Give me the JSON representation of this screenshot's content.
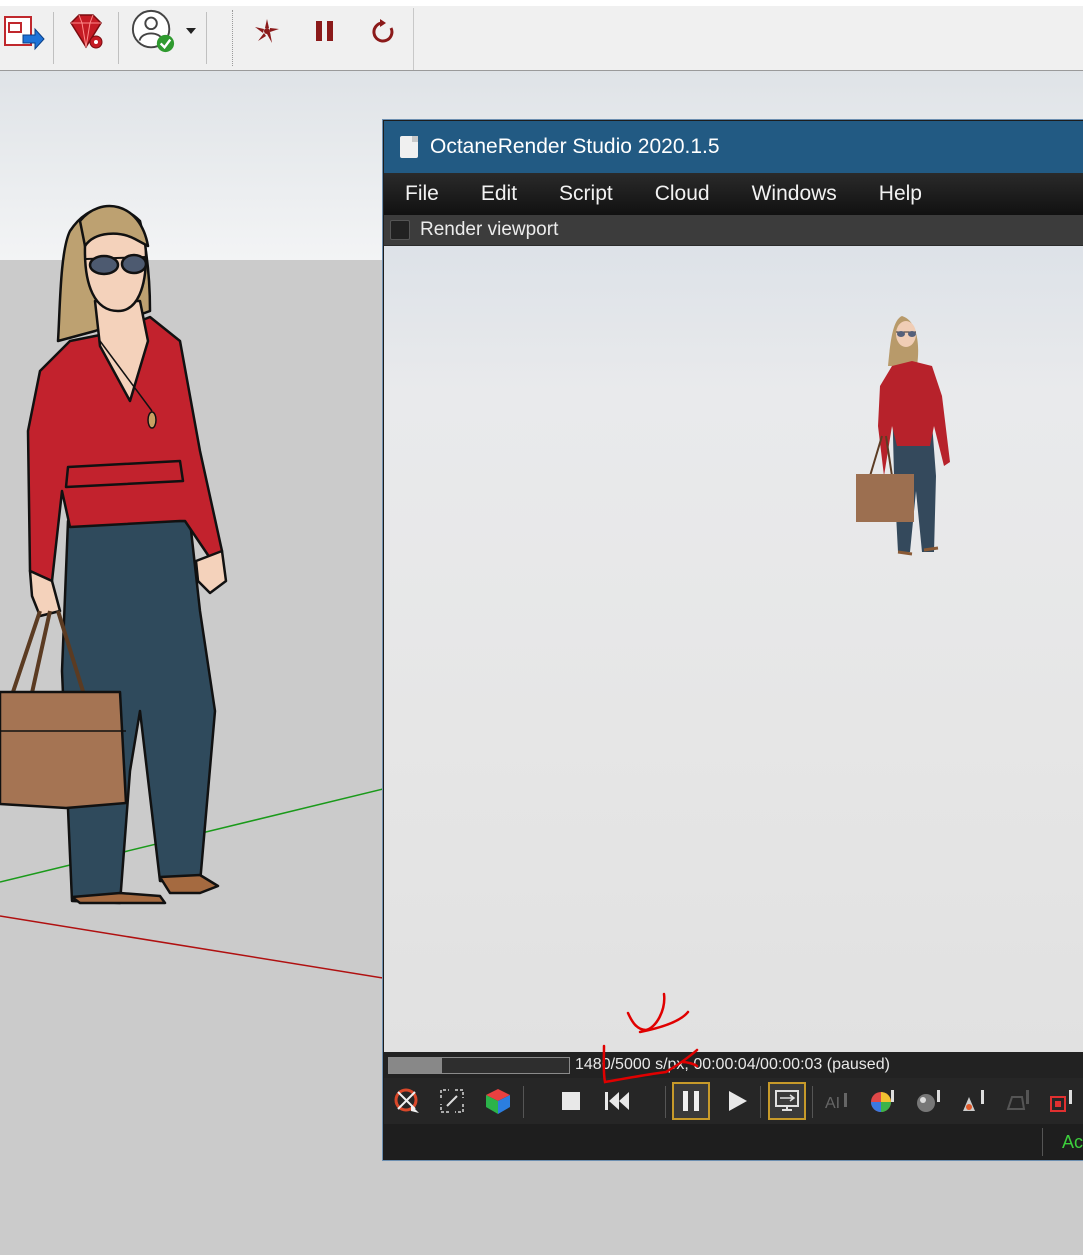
{
  "toolbar": {
    "icons": [
      "export-icon",
      "ruby-gem-icon",
      "account-icon",
      "octane-render-icon",
      "pause-icon",
      "restart-icon"
    ],
    "account_status_color": "#2f9a2f",
    "octane_icon_color": "#8b1a1a"
  },
  "octane": {
    "title": "OctaneRender Studio 2020.1.5",
    "title_bar_color": "#225a83",
    "menu": [
      "File",
      "Edit",
      "Script",
      "Cloud",
      "Windows",
      "Help"
    ],
    "viewport_label": "Render viewport",
    "status": {
      "text": "1480/5000 s/px, 00:00:04/00:00:03 (paused)",
      "progress": 0.296
    },
    "tool_icons": [
      "focus-picker-icon",
      "fit-view-icon",
      "color-cube-icon",
      "stop-icon",
      "restart-render-icon",
      "pause-render-icon",
      "play-icon",
      "viewport-lock-icon",
      "ai-denoise-icon",
      "color-wheel-icon",
      "material-ball-icon",
      "light-picker-icon",
      "object-picker-icon",
      "region-render-icon"
    ],
    "bottom_status": "Ac",
    "bottom_status_color": "#3ccf3c",
    "annotation_color": "#e00000"
  }
}
